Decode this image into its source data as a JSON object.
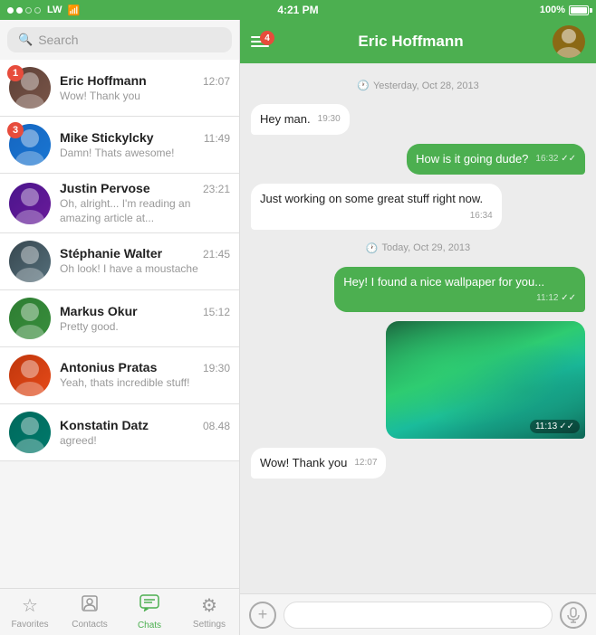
{
  "statusBar": {
    "signal": "●●○○",
    "carrier": "LW",
    "time": "4:21 PM",
    "battery": "100%"
  },
  "search": {
    "placeholder": "Search"
  },
  "chatList": [
    {
      "id": 1,
      "name": "Eric Hoffmann",
      "time": "12:07",
      "preview": "Wow! Thank you",
      "badge": 1,
      "avatarClass": "av-eric"
    },
    {
      "id": 2,
      "name": "Mike Stickylcky",
      "time": "11:49",
      "preview": "Damn! Thats awesome!",
      "badge": 3,
      "avatarClass": "av-mike"
    },
    {
      "id": 3,
      "name": "Justin Pervose",
      "time": "23:21",
      "preview": "Oh, alright... I'm reading an amazing article at...",
      "badge": 0,
      "avatarClass": "av-justin"
    },
    {
      "id": 4,
      "name": "Stéphanie Walter",
      "time": "21:45",
      "preview": "Oh look! I have a moustache",
      "badge": 0,
      "avatarClass": "av-stephanie"
    },
    {
      "id": 5,
      "name": "Markus Okur",
      "time": "15:12",
      "preview": "Pretty good.",
      "badge": 0,
      "avatarClass": "av-markus"
    },
    {
      "id": 6,
      "name": "Antonius Pratas",
      "time": "19:30",
      "preview": "Yeah, thats incredible stuff!",
      "badge": 0,
      "avatarClass": "av-antonius"
    },
    {
      "id": 7,
      "name": "Konstatin Datz",
      "time": "08.48",
      "preview": "agreed!",
      "badge": 0,
      "avatarClass": "av-konstatin"
    }
  ],
  "chatHeader": {
    "menuBadge": "4",
    "title": "Eric Hoffmann"
  },
  "messages": [
    {
      "id": 1,
      "type": "date",
      "text": "Yesterday, Oct 28, 2013"
    },
    {
      "id": 2,
      "type": "received",
      "text": "Hey man.",
      "time": "19:30"
    },
    {
      "id": 3,
      "type": "sent",
      "text": "How is it going dude?",
      "time": "16:32",
      "ticks": "✓✓"
    },
    {
      "id": 4,
      "type": "received",
      "text": "Just working on some great stuff right now.",
      "time": "16:34"
    },
    {
      "id": 5,
      "type": "date",
      "text": "Today, Oct 29, 2013"
    },
    {
      "id": 6,
      "type": "sent",
      "text": "Hey! I found a nice wallpaper for you...",
      "time": "11:12",
      "ticks": "✓✓"
    },
    {
      "id": 7,
      "type": "image",
      "time": "11:13",
      "ticks": "✓✓"
    },
    {
      "id": 8,
      "type": "received",
      "text": "Wow! Thank you",
      "time": "12:07"
    }
  ],
  "tabs": [
    {
      "id": "favorites",
      "label": "Favorites",
      "icon": "☆"
    },
    {
      "id": "contacts",
      "label": "Contacts",
      "icon": "👤"
    },
    {
      "id": "chats",
      "label": "Chats",
      "icon": "💬",
      "active": true
    },
    {
      "id": "settings",
      "label": "Settings",
      "icon": "⚙"
    }
  ],
  "inputBar": {
    "placeholder": ""
  }
}
